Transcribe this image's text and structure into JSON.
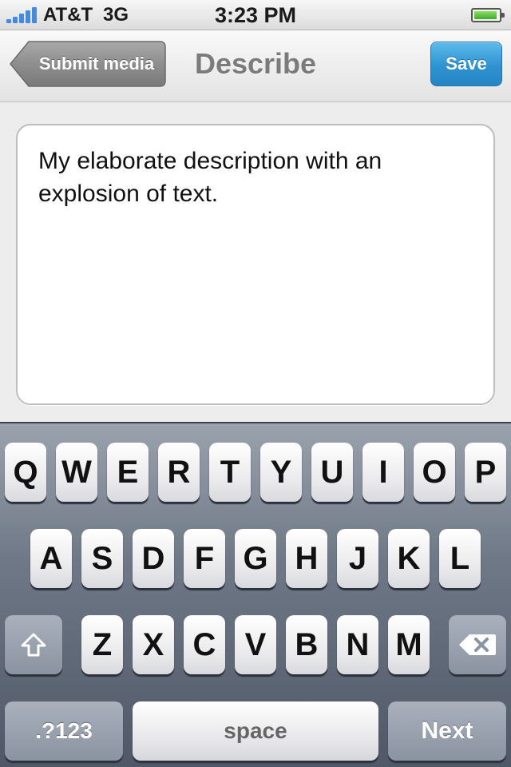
{
  "status_bar": {
    "carrier": "AT&T",
    "network": "3G",
    "time": "3:23 PM",
    "signal_icon": "signal-bars-icon",
    "battery_icon": "battery-icon"
  },
  "nav": {
    "back_label": "Submit media",
    "title": "Describe",
    "save_label": "Save"
  },
  "description": {
    "value": "My elaborate description with an explosion of text."
  },
  "keyboard": {
    "row1": [
      "Q",
      "W",
      "E",
      "R",
      "T",
      "Y",
      "U",
      "I",
      "O",
      "P"
    ],
    "row2": [
      "A",
      "S",
      "D",
      "F",
      "G",
      "H",
      "J",
      "K",
      "L"
    ],
    "row3": [
      "Z",
      "X",
      "C",
      "V",
      "B",
      "N",
      "M"
    ],
    "shift_icon": "shift-arrow-icon",
    "delete_icon": "backspace-icon",
    "numbers_label": ".?123",
    "space_label": "space",
    "next_label": "Next"
  },
  "colors": {
    "save_button": "#2f93d1",
    "back_button": "#8c8c8c",
    "keyboard_bg": "#6f7886"
  }
}
